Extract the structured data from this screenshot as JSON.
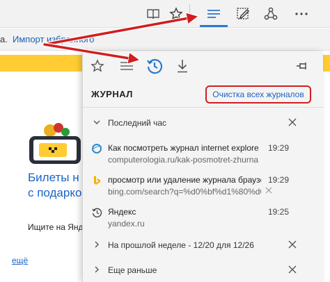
{
  "toolbar": {
    "icons": [
      "reading-view-icon",
      "favorite-star-icon",
      "hub-icon",
      "web-note-icon",
      "share-icon",
      "more-icon"
    ]
  },
  "favbar": {
    "prefix": "а.",
    "import_link": "Импорт избранного"
  },
  "page": {
    "title_line1": "Билеты н",
    "title_line2": "с подарко",
    "subtitle": "Ищите на Янд",
    "more_link": "ещё"
  },
  "hub": {
    "tabs": [
      "favorites-star-icon",
      "reading-list-icon",
      "history-icon",
      "downloads-icon"
    ],
    "active_tab": "history-icon",
    "title": "ЖУРНАЛ",
    "clear_button": "Очистка всех журналов",
    "groups": {
      "last_hour": "Последний час",
      "last_week": "На прошлой неделе - 12/20 для 12/26",
      "earlier": "Еще раньше"
    },
    "items": [
      {
        "icon": "ie-favicon-icon",
        "title": "Как посмотреть журнал internet explore",
        "url": "computerologia.ru/kak-posmotret-zhurna",
        "time": "19:29"
      },
      {
        "icon": "bing-favicon-icon",
        "title": "просмотр или удаление журнала браузе",
        "url": "bing.com/search?q=%d0%bf%d1%80%d0%",
        "time": "19:29"
      },
      {
        "icon": "history-clock-icon",
        "title": "Яндекс",
        "url": "yandex.ru",
        "time": "19:25"
      }
    ]
  },
  "colors": {
    "accent": "#2b78d0",
    "annotation": "#d11e1e",
    "link": "#1a63c4",
    "yellow": "#ffcc33"
  }
}
